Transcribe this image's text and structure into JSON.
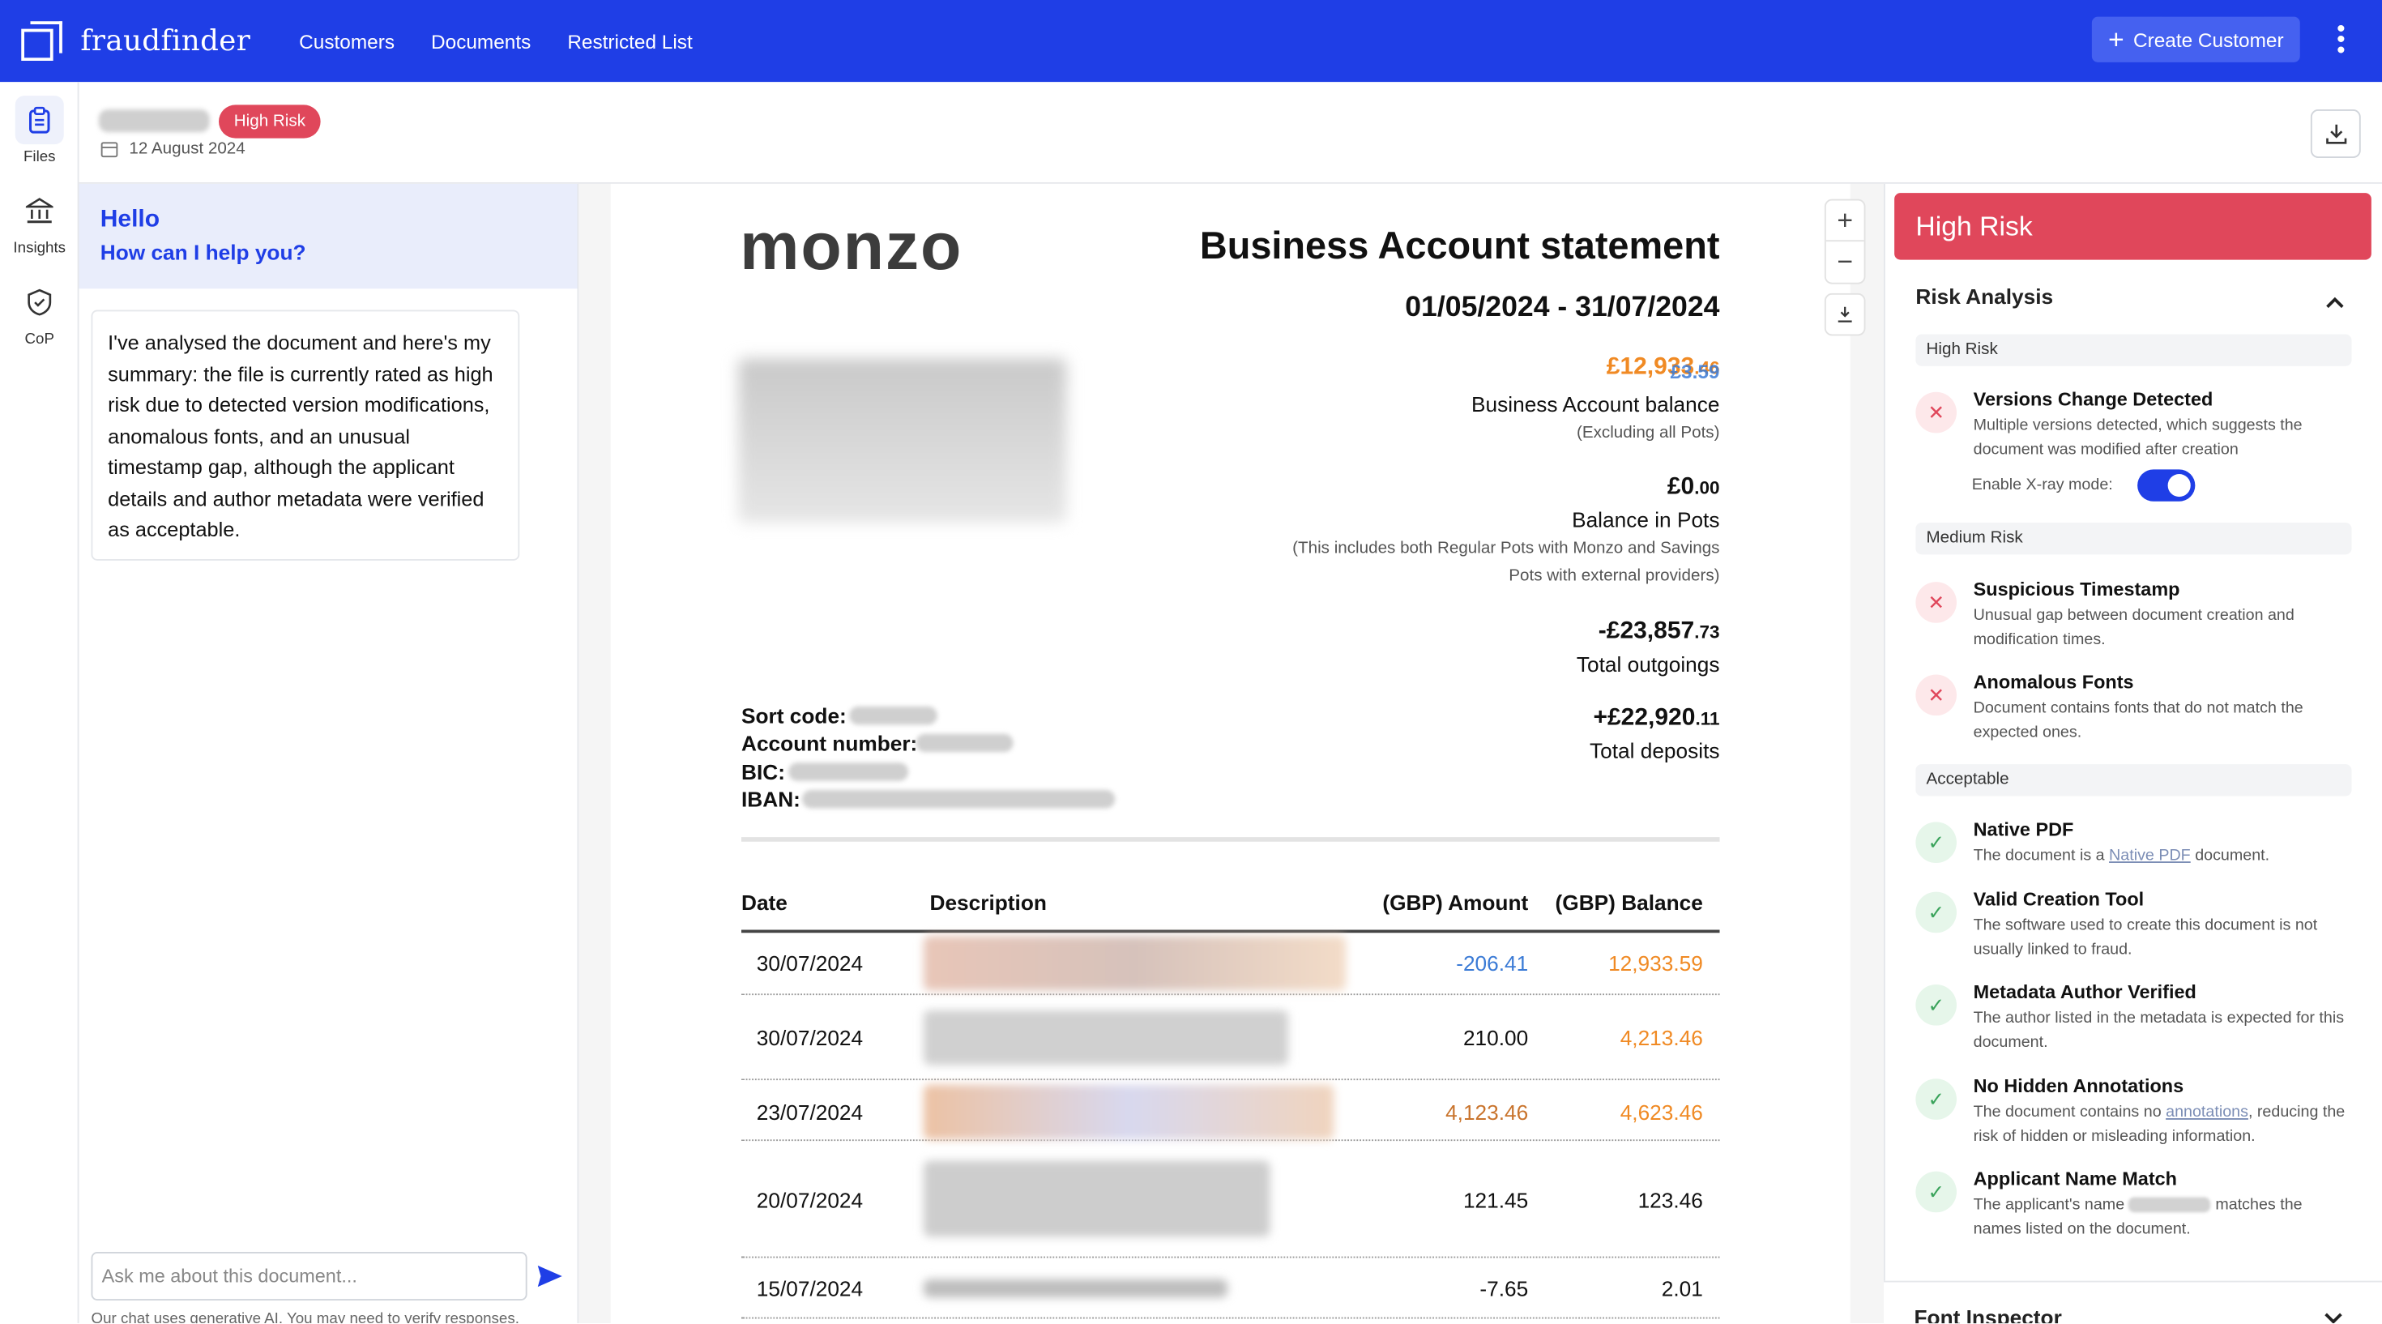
{
  "app": {
    "brand": "fraudfinder",
    "nav": [
      "Customers",
      "Documents",
      "Restricted List"
    ],
    "create_label": "Create Customer",
    "menu_icon": "kebab-icon"
  },
  "rail": [
    {
      "label": "Files",
      "icon": "clipboard-icon"
    },
    {
      "label": "Insights",
      "icon": "bank-icon"
    },
    {
      "label": "CoP",
      "icon": "shield-check-icon"
    }
  ],
  "header": {
    "risk_badge": "High Risk",
    "date": "12 August 2024"
  },
  "chat": {
    "hello": "Hello",
    "help": "How can I help you?",
    "message": "I've analysed the document and here's my summary: the file is currently rated as high risk due to detected version modifications, anomalous fonts, and an unusual timestamp gap, although the applicant details and author metadata were verified as acceptable.",
    "placeholder": "Ask me about this document...",
    "disclaimer": "Our chat uses generative AI. You may need to verify responses."
  },
  "document": {
    "logo": "monzo",
    "title": "Business Account statement",
    "period": "01/05/2024 - 31/07/2024",
    "balance_amount": "£12,933",
    "balance_pence": ".46",
    "balance_overlay": "£3.59",
    "balance_label": "Business Account balance",
    "balance_note": "(Excluding all Pots)",
    "pots_amount": "£0",
    "pots_pence": ".00",
    "pots_label": "Balance in Pots",
    "pots_note_1": "(This includes both Regular Pots with Monzo and Savings",
    "pots_note_2": "Pots with external providers)",
    "outgoings_amount": "-£23,857",
    "outgoings_pence": ".73",
    "outgoings_label": "Total outgoings",
    "deposits_amount": "+£22,920",
    "deposits_pence": ".11",
    "deposits_label": "Total deposits",
    "sort_code_label": "Sort code:",
    "account_number_label": "Account number:",
    "bic_label": "BIC:",
    "iban_label": "IBAN:",
    "columns": [
      "Date",
      "Description",
      "(GBP) Amount",
      "(GBP) Balance"
    ],
    "rows": [
      {
        "date": "30/07/2024",
        "amount": "-206.41",
        "balance": "12,933.59"
      },
      {
        "date": "30/07/2024",
        "amount": "210.00",
        "balance": "4,213.46"
      },
      {
        "date": "23/07/2024",
        "amount": "4,123.46",
        "balance": "4,623.46"
      },
      {
        "date": "20/07/2024",
        "amount": "121.45",
        "balance": "123.46"
      },
      {
        "date": "15/07/2024",
        "amount": "-7.65",
        "balance": "2.01"
      }
    ]
  },
  "risk": {
    "banner": "High Risk",
    "analysis_title": "Risk Analysis",
    "sections": {
      "high": "High Risk",
      "medium": "Medium Risk",
      "acceptable": "Acceptable"
    },
    "xray_label": "Enable X-ray mode:",
    "xray_enabled": true,
    "items": {
      "versions": {
        "title": "Versions Change Detected",
        "desc": "Multiple versions detected, which suggests the document was modified after creation"
      },
      "timestamp": {
        "title": "Suspicious Timestamp",
        "desc": "Unusual gap between document creation and modification times."
      },
      "fonts": {
        "title": "Anomalous Fonts",
        "desc": "Document contains fonts that do not match the expected ones."
      },
      "native": {
        "title": "Native PDF",
        "desc_pre": "The document is a ",
        "desc_link": "Native PDF",
        "desc_post": " document."
      },
      "creation": {
        "title": "Valid Creation Tool",
        "desc": "The software used to create this document is not usually linked to fraud."
      },
      "author": {
        "title": "Metadata Author Verified",
        "desc": "The author listed in the metadata is expected for this document."
      },
      "annotations": {
        "title": "No Hidden Annotations",
        "desc_pre": "The document contains no ",
        "desc_link": "annotations",
        "desc_post": ", reducing the risk of hidden or misleading information."
      },
      "applicant": {
        "title": "Applicant Name Match",
        "desc_pre": "The applicant's name",
        "desc_post": "matches the names listed on the document."
      }
    },
    "font_inspector": "Font Inspector"
  },
  "colors": {
    "brand": "#1f3ee6",
    "danger": "#e0475b",
    "success": "#3aa35b",
    "overlay_orange": "#f08a24",
    "overlay_blue": "#3b7bd6"
  }
}
